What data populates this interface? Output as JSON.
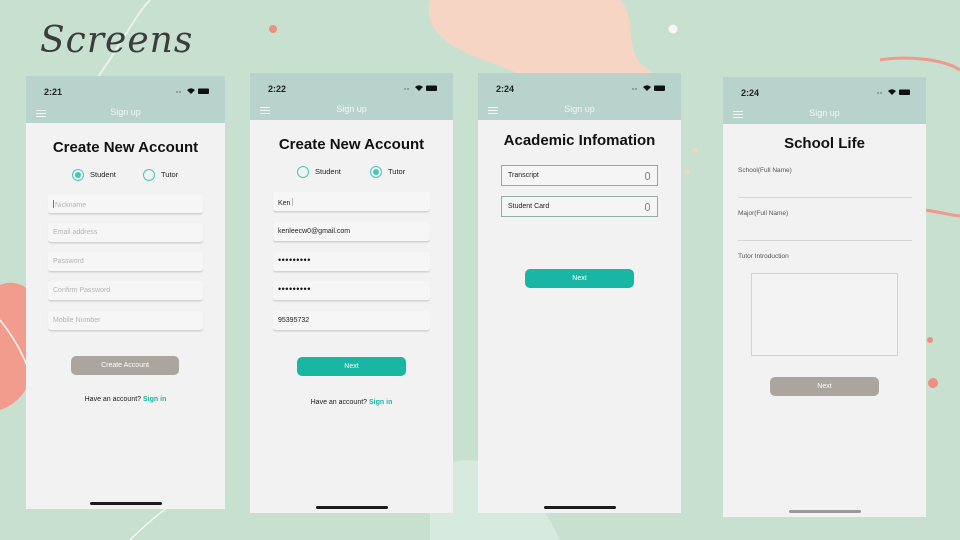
{
  "slide": {
    "title": "Screens"
  },
  "colors": {
    "background": "#c7e0cf",
    "header": "#b7d3cc",
    "teal": "#1ab6a4",
    "gray_button": "#aaa59e",
    "radio": "#47c7b8"
  },
  "screen1": {
    "time": "2:21",
    "nav_title": "Sign up",
    "heading": "Create New Account",
    "radio_student": "Student",
    "radio_tutor": "Tutor",
    "selected": "Student",
    "placeholders": {
      "nickname": "Nickname",
      "email": "Email address",
      "password": "Password",
      "confirm": "Confirm Password",
      "mobile": "Mobile Number"
    },
    "button": "Create Account",
    "signin_prefix": "Have an account?",
    "signin_link": "Sign in"
  },
  "screen2": {
    "time": "2:22",
    "nav_title": "Sign up",
    "heading": "Create New Account",
    "radio_student": "Student",
    "radio_tutor": "Tutor",
    "selected": "Tutor",
    "values": {
      "nickname": "Ken",
      "email": "kenleecw0@gmail.com",
      "password": "•••••••••",
      "confirm": "•••••••••",
      "mobile": "95395732"
    },
    "button": "Next",
    "signin_prefix": "Have an account?",
    "signin_link": "Sign in"
  },
  "screen3": {
    "time": "2:24",
    "nav_title": "Sign up",
    "heading": "Academic Infomation",
    "upload_transcript": "Transcript",
    "upload_student_card": "Student Card",
    "button": "Next"
  },
  "screen4": {
    "time": "2:24",
    "nav_title": "Sign up",
    "heading": "School Life",
    "label_school": "School(Full Name)",
    "label_major": "Major(Full Name)",
    "label_intro": "Tutor Introduction",
    "button": "Next"
  }
}
